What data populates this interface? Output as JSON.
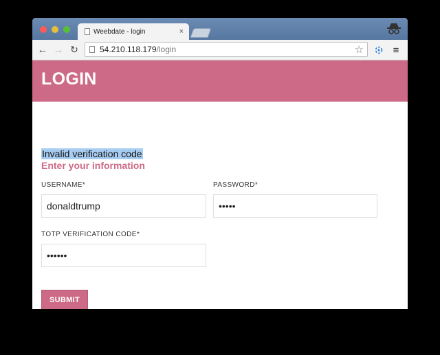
{
  "browser": {
    "tab_title": "Weebdate - login",
    "tab_close": "×",
    "url_host": "54.210.118.179",
    "url_path": "/login",
    "star": "☆",
    "back": "←",
    "forward": "→",
    "reload": "↻",
    "menu": "≡"
  },
  "page": {
    "title": "LOGIN",
    "error_message": "Invalid verification code",
    "subtitle": "Enter your information",
    "username_label": "USERNAME",
    "password_label": "PASSWORD",
    "totp_label": "TOTP VERIFICATION CODE",
    "required_mark": "*",
    "username_value": "donaldtrump",
    "password_value": "•••••",
    "totp_value": "••••••",
    "submit_label": "SUBMIT"
  },
  "colors": {
    "accent": "#cd6a87",
    "highlight": "#a8cdf2"
  }
}
